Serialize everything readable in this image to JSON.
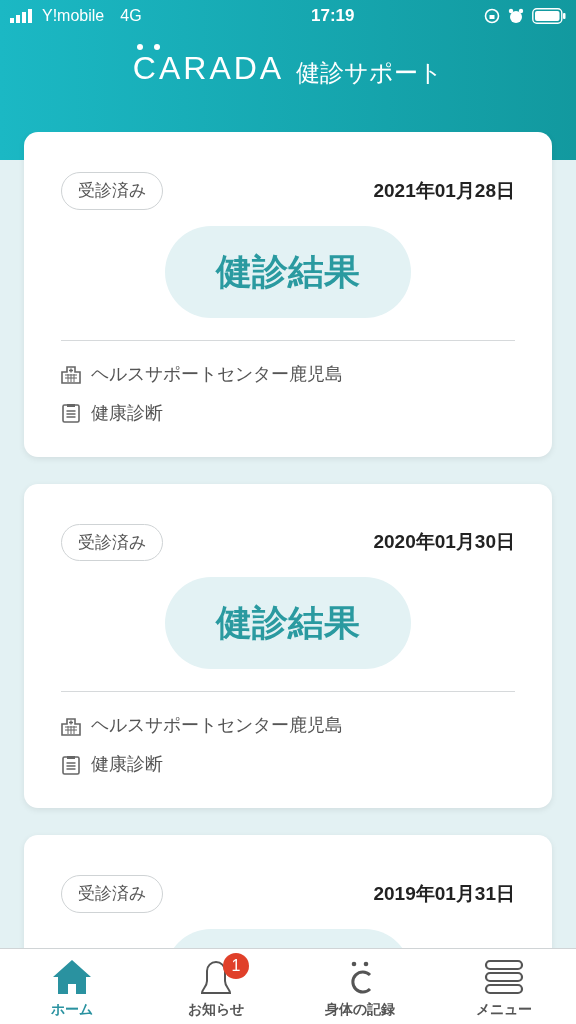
{
  "status_bar": {
    "carrier": "Y!mobile",
    "network": "4G",
    "time": "17:19"
  },
  "header": {
    "logo": "CARADA",
    "title": "健診サポート"
  },
  "cards": [
    {
      "status": "受診済み",
      "date": "2021年01月28日",
      "result_button": "健診結果",
      "facility": "ヘルスサポートセンター鹿児島",
      "exam_type": "健康診断"
    },
    {
      "status": "受診済み",
      "date": "2020年01月30日",
      "result_button": "健診結果",
      "facility": "ヘルスサポートセンター鹿児島",
      "exam_type": "健康診断"
    },
    {
      "status": "受診済み",
      "date": "2019年01月31日"
    }
  ],
  "tab_bar": [
    {
      "kind": "home",
      "label": "ホーム",
      "selected": true
    },
    {
      "kind": "bell",
      "label": "お知らせ",
      "selected": false,
      "badge": "1"
    },
    {
      "kind": "body",
      "label": "身体の記録",
      "selected": false
    },
    {
      "kind": "menu",
      "label": "メニュー",
      "selected": false
    }
  ]
}
